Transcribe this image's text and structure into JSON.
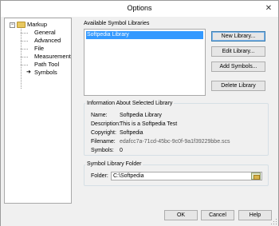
{
  "window": {
    "title": "Options",
    "close_glyph": "✕"
  },
  "tree": {
    "root": "Markup",
    "items": [
      "General",
      "Advanced",
      "File",
      "Measurement",
      "Path Tool",
      "Symbols"
    ],
    "selected": "Symbols"
  },
  "libraries": {
    "label": "Available Symbol Libraries",
    "items": [
      "Softpedia Library"
    ],
    "buttons": {
      "new": "New Library...",
      "edit": "Edit Library...",
      "add_symbols": "Add Symbols...",
      "delete": "Delete Library"
    }
  },
  "info": {
    "label": "Information About Selected Library",
    "name_key": "Name:",
    "name_val": "Softpedia Library",
    "description_key": "Description:",
    "description_val": "This is a Softpedia Test",
    "copyright_key": "Copyright:",
    "copyright_val": "Softpedia",
    "filename_key": "Filename:",
    "filename_val": "edafcc7a-71cd-45bc-9c0f-9a1f39229bbe.scs",
    "symbols_key": "Symbols:",
    "symbols_val": "0"
  },
  "folder": {
    "label": "Symbol Library Folder",
    "key": "Folder:",
    "value": "C:\\Softpedia"
  },
  "footer": {
    "ok": "OK",
    "cancel": "Cancel",
    "help": "Help"
  },
  "icons": [
    "close-icon",
    "expander-minus-icon",
    "folder-icon",
    "current-arrow-icon",
    "browse-folder-icon",
    "resize-grip-icon"
  ]
}
